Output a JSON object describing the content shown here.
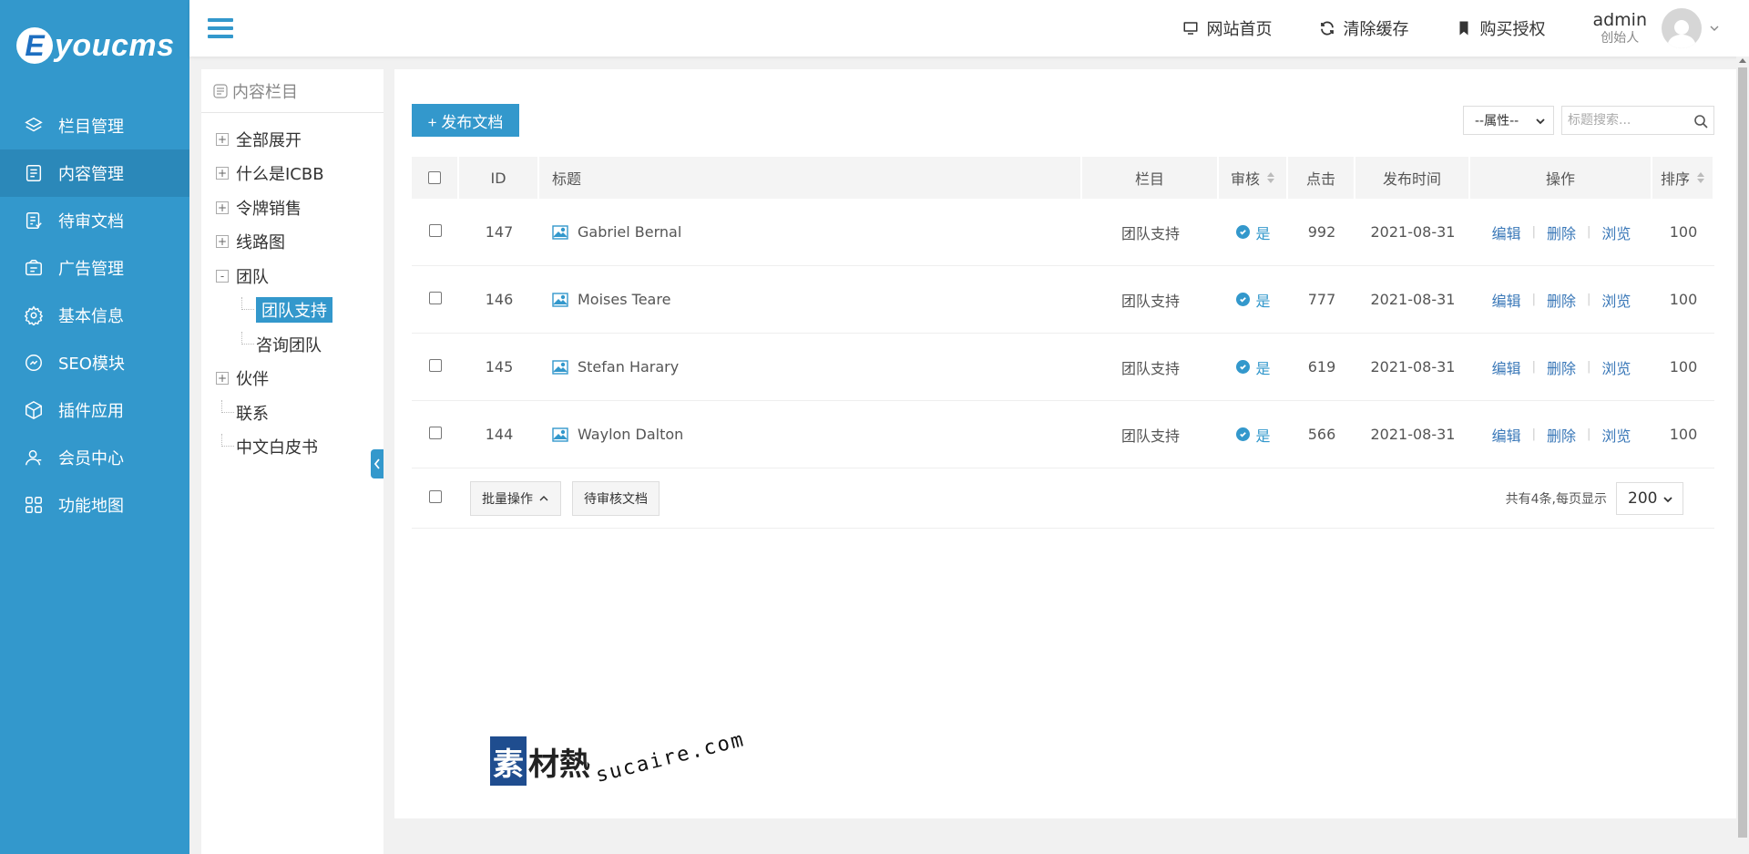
{
  "brand": {
    "logo_letter": "E",
    "logo_text": "youcms"
  },
  "sidebar": {
    "items": [
      {
        "label": "栏目管理",
        "icon": "layers-icon"
      },
      {
        "label": "内容管理",
        "icon": "document-icon"
      },
      {
        "label": "待审文档",
        "icon": "review-doc-icon"
      },
      {
        "label": "广告管理",
        "icon": "ad-icon"
      },
      {
        "label": "基本信息",
        "icon": "gear-icon"
      },
      {
        "label": "SEO模块",
        "icon": "seo-icon"
      },
      {
        "label": "插件应用",
        "icon": "cube-icon"
      },
      {
        "label": "会员中心",
        "icon": "user-icon"
      },
      {
        "label": "功能地图",
        "icon": "grid-icon"
      }
    ],
    "active_index": 1
  },
  "topbar": {
    "links": [
      {
        "label": "网站首页",
        "icon": "monitor-icon"
      },
      {
        "label": "清除缓存",
        "icon": "refresh-icon"
      },
      {
        "label": "购买授权",
        "icon": "bookmark-icon"
      }
    ],
    "user": {
      "name": "admin",
      "role": "创始人"
    }
  },
  "tree": {
    "title": "内容栏目",
    "nodes": [
      {
        "label": "全部展开",
        "toggle": "+"
      },
      {
        "label": "什么是ICBB",
        "toggle": "+"
      },
      {
        "label": "令牌销售",
        "toggle": "+"
      },
      {
        "label": "线路图",
        "toggle": "+"
      },
      {
        "label": "团队",
        "toggle": "-"
      },
      {
        "label": "团队支持",
        "child": true,
        "selected": true
      },
      {
        "label": "咨询团队",
        "child": true
      },
      {
        "label": "伙伴",
        "toggle": "+"
      },
      {
        "label": "联系"
      },
      {
        "label": "中文白皮书"
      }
    ]
  },
  "toolbar": {
    "publish_label": "+ 发布文档",
    "attr_select": "--属性--",
    "search_placeholder": "标题搜索..."
  },
  "table": {
    "headers": {
      "id": "ID",
      "title": "标题",
      "column": "栏目",
      "audit": "审核",
      "clicks": "点击",
      "date": "发布时间",
      "ops": "操作",
      "sort": "排序"
    },
    "rows": [
      {
        "id": "147",
        "title": "Gabriel Bernal",
        "column": "团队支持",
        "audit": "是",
        "clicks": "992",
        "date": "2021-08-31",
        "sort": "100"
      },
      {
        "id": "146",
        "title": "Moises Teare",
        "column": "团队支持",
        "audit": "是",
        "clicks": "777",
        "date": "2021-08-31",
        "sort": "100"
      },
      {
        "id": "145",
        "title": "Stefan Harary",
        "column": "团队支持",
        "audit": "是",
        "clicks": "619",
        "date": "2021-08-31",
        "sort": "100"
      },
      {
        "id": "144",
        "title": "Waylon Dalton",
        "column": "团队支持",
        "audit": "是",
        "clicks": "566",
        "date": "2021-08-31",
        "sort": "100"
      }
    ],
    "ops": {
      "edit": "编辑",
      "delete": "删除",
      "view": "浏览"
    }
  },
  "footer": {
    "batch_label": "批量操作",
    "pending_label": "待审核文档",
    "summary": "共有4条,每页显示",
    "page_size": "200"
  },
  "watermark": {
    "box": "素",
    "cn": "材熱",
    "en": "sucaire.com"
  },
  "colors": {
    "accent": "#3398cc",
    "link": "#3a78b8"
  }
}
